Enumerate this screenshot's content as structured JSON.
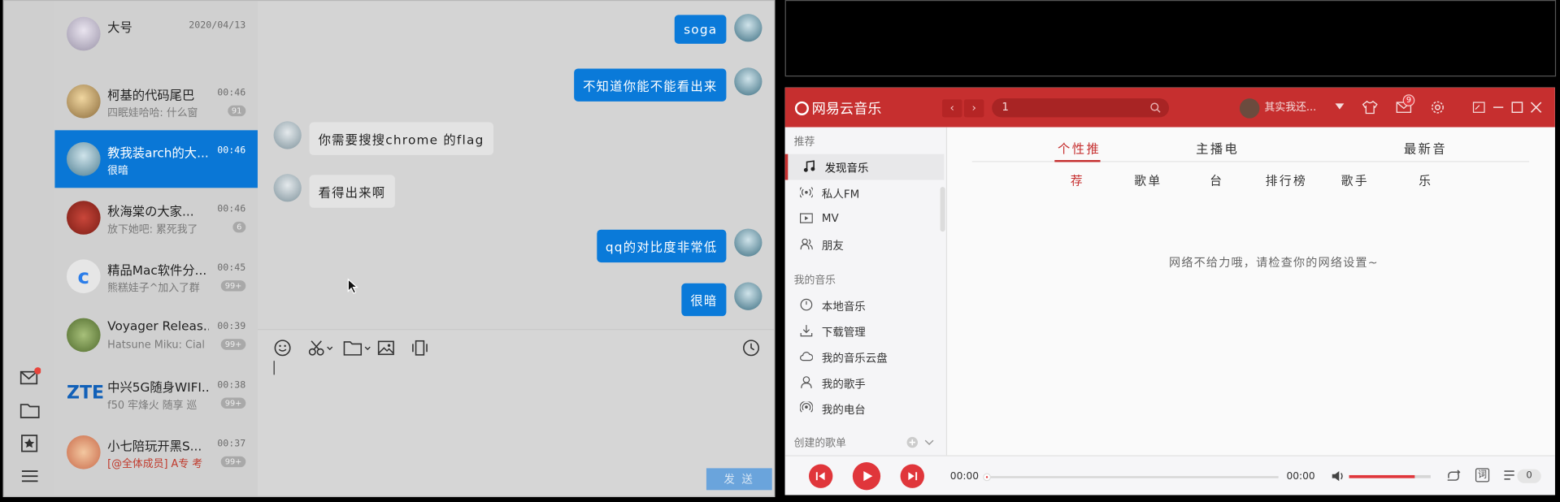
{
  "qq": {
    "conversations": [
      {
        "name": "大号",
        "time": "2020/04/13",
        "preview": "",
        "badge": ""
      },
      {
        "name": "柯基的代码尾巴",
        "time": "00:46",
        "preview": "四眠娃哈哈: 什么窗",
        "badge": "91"
      },
      {
        "name": "教我装arch的大...",
        "time": "00:46",
        "preview": "很暗",
        "badge": ""
      },
      {
        "name": "秋海棠の大家...",
        "time": "00:46",
        "preview": "放下她吧: 累死我了",
        "badge": "6"
      },
      {
        "name": "精品Mac软件分...",
        "time": "00:45",
        "preview": "熊糕娃子^加入了群",
        "badge": "99+"
      },
      {
        "name": "Voyager Releas...",
        "time": "00:39",
        "preview": "Hatsune Miku: Cial",
        "badge": "99+"
      },
      {
        "name": "中兴5G随身WIFI...",
        "time": "00:38",
        "preview": "f50 牢烽火 随享 巡",
        "badge": "99+"
      },
      {
        "name": "小七陪玩开黑S...",
        "time": "00:37",
        "preview": "[@全体成员] A专 考",
        "badge": "99+"
      }
    ],
    "messages": [
      {
        "from": "me",
        "text": "soga"
      },
      {
        "from": "me",
        "text": "不知道你能不能看出来"
      },
      {
        "from": "them",
        "text": "你需要搜搜chrome 的flag"
      },
      {
        "from": "them",
        "text": "看得出来啊"
      },
      {
        "from": "me",
        "text": "qq的对比度非常低"
      },
      {
        "from": "me",
        "text": "很暗"
      }
    ],
    "send_label": "发 送"
  },
  "netease": {
    "logo": "网易云音乐",
    "search_value": "1",
    "username": "其实我还...",
    "mail_count": "9",
    "side_sections": {
      "recommend": "推荐",
      "my_music": "我的音乐",
      "created": "创建的歌单"
    },
    "recommend_items": [
      "发现音乐",
      "私人FM",
      "MV",
      "朋友"
    ],
    "my_music_items": [
      "本地音乐",
      "下载管理",
      "我的音乐云盘",
      "我的歌手",
      "我的电台"
    ],
    "tabs": [
      "个性推",
      "主播电",
      "最新音"
    ],
    "subtabs": [
      "荐",
      "歌单",
      "台",
      "排行榜",
      "歌手",
      "乐"
    ],
    "network_msg": "网络不给力哦，请检查你的网络设置~",
    "time_current": "00:00",
    "time_total": "00:00",
    "volume": 0.8,
    "lyric_label": "词",
    "playlist_count": "0"
  },
  "colors": {
    "qq_accent": "#0a77d6",
    "netease_red": "#c62f2f"
  }
}
